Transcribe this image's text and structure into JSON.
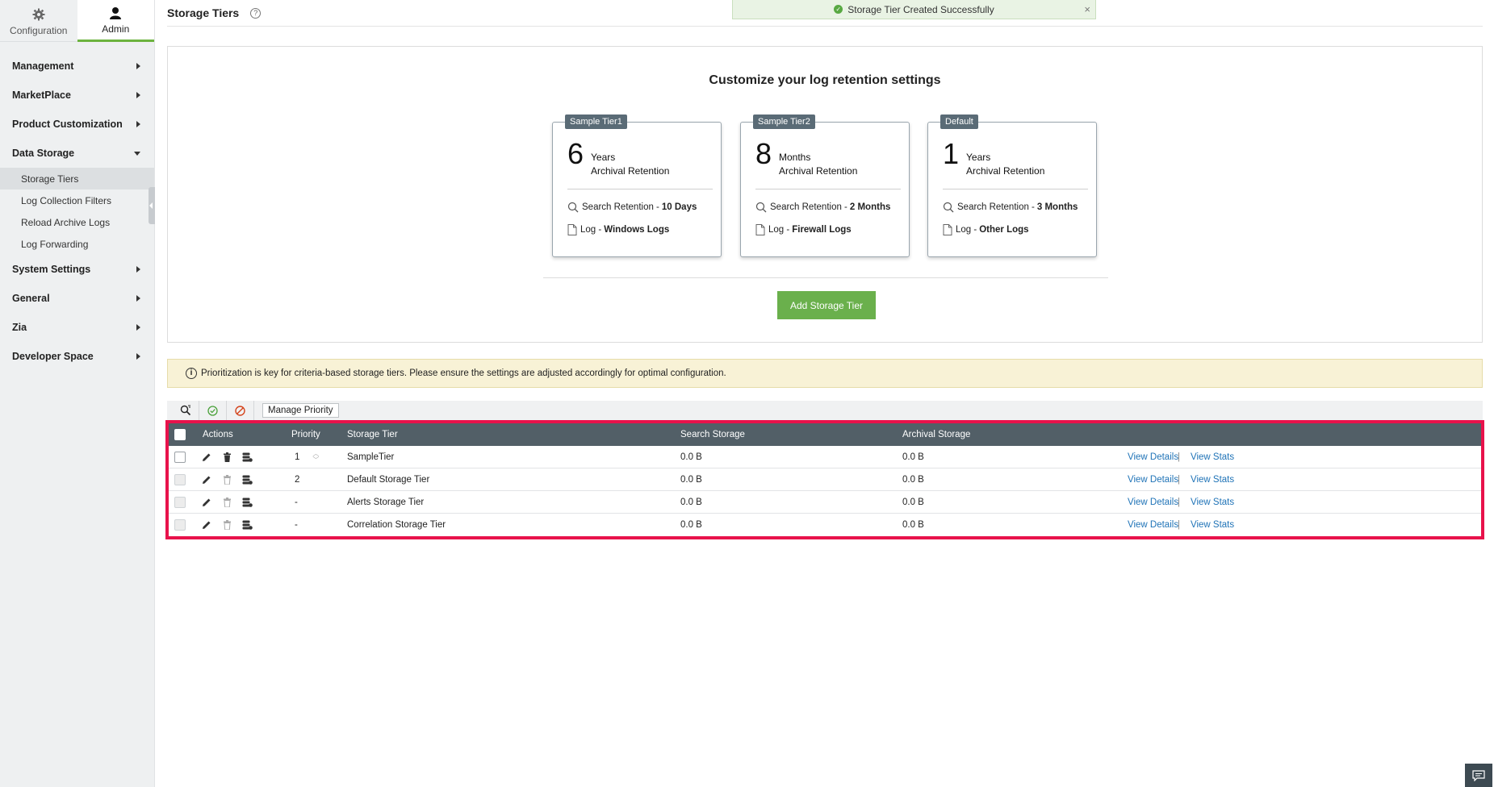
{
  "sidebar": {
    "tabs": [
      {
        "label": "Configuration",
        "icon": "gear-icon"
      },
      {
        "label": "Admin",
        "icon": "user-icon"
      }
    ],
    "menu": [
      {
        "label": "Management"
      },
      {
        "label": "MarketPlace"
      },
      {
        "label": "Product Customization"
      },
      {
        "label": "Data Storage",
        "expanded": true,
        "children": [
          "Storage Tiers",
          "Log Collection Filters",
          "Reload Archive Logs",
          "Log Forwarding"
        ]
      },
      {
        "label": "System Settings"
      },
      {
        "label": "General"
      },
      {
        "label": "Zia"
      },
      {
        "label": "Developer Space"
      }
    ],
    "active_child": "Storage Tiers"
  },
  "header": {
    "title": "Storage Tiers",
    "help_glyph": "?"
  },
  "toast": {
    "message": "Storage Tier Created Successfully",
    "close": "×"
  },
  "panel": {
    "title": "Customize your log retention settings",
    "cards": [
      {
        "badge": "Sample Tier1",
        "number": "6",
        "unit": "Years",
        "archival": "Archival Retention",
        "search_label": "Search Retention -",
        "search_value": "10 Days",
        "log_label": "Log -",
        "log_value": "Windows Logs"
      },
      {
        "badge": "Sample Tier2",
        "number": "8",
        "unit": "Months",
        "archival": "Archival Retention",
        "search_label": "Search Retention -",
        "search_value": "2 Months",
        "log_label": "Log -",
        "log_value": "Firewall Logs"
      },
      {
        "badge": "Default",
        "number": "1",
        "unit": "Years",
        "archival": "Archival Retention",
        "search_label": "Search Retention -",
        "search_value": "3 Months",
        "log_label": "Log -",
        "log_value": "Other Logs"
      }
    ],
    "add_button": "Add Storage Tier"
  },
  "info": {
    "glyph": "i",
    "text": "Prioritization is key for criteria-based storage tiers. Please ensure the settings are adjusted accordingly for optimal configuration."
  },
  "toolbar": {
    "manage_priority": "Manage Priority"
  },
  "table": {
    "headers": {
      "actions": "Actions",
      "priority": "Priority",
      "storage_tier": "Storage Tier",
      "search_storage": "Search Storage",
      "archival_storage": "Archival Storage"
    },
    "rows": [
      {
        "priority": "1",
        "name": "SampleTier",
        "search": "0.0 B",
        "archival": "0.0 B",
        "view_details": "View Details",
        "sep": "|",
        "view_stats": "View Stats"
      },
      {
        "priority": "2",
        "name": "Default Storage Tier",
        "search": "0.0 B",
        "archival": "0.0 B",
        "view_details": "View Details",
        "sep": "|",
        "view_stats": "View Stats"
      },
      {
        "priority": "-",
        "name": "Alerts Storage Tier",
        "search": "0.0 B",
        "archival": "0.0 B",
        "view_details": "View Details",
        "sep": "|",
        "view_stats": "View Stats"
      },
      {
        "priority": "-",
        "name": "Correlation Storage Tier",
        "search": "0.0 B",
        "archival": "0.0 B",
        "view_details": "View Details",
        "sep": "|",
        "view_stats": "View Stats"
      }
    ]
  },
  "colors": {
    "accent_green": "#6ab04c",
    "table_header": "#525f67",
    "highlight_border": "#e8124b",
    "link": "#1f73b7"
  }
}
